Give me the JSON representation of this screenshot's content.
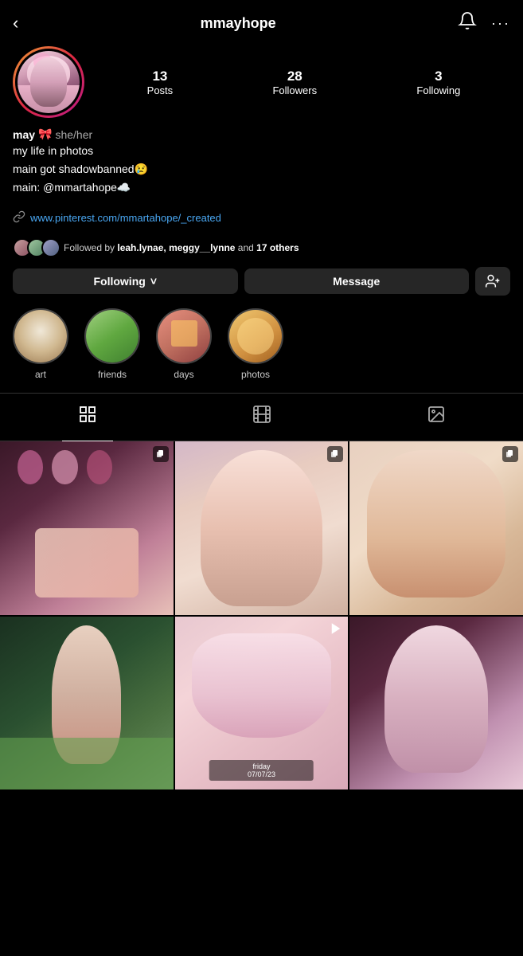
{
  "header": {
    "username": "mmayhope",
    "back_label": "‹",
    "bell_label": "🔔",
    "more_label": "···"
  },
  "stats": {
    "posts_count": "13",
    "posts_label": "Posts",
    "followers_count": "28",
    "followers_label": "Followers",
    "following_count": "3",
    "following_label": "Following"
  },
  "bio": {
    "name": "may",
    "bow": "🎀",
    "pronouns": "she/her",
    "line1": "my life in photos",
    "line2": "main got shadowbanned😢",
    "line3": "main: @mmartahope☁️"
  },
  "link": {
    "url": "www.pinterest.com/mmartahope/_created"
  },
  "followed_by": {
    "text_prefix": "Followed by ",
    "users": "leah.lynae, meggy__lynne",
    "text_suffix": " and ",
    "others_count": "17 others"
  },
  "buttons": {
    "following_label": "Following",
    "message_label": "Message",
    "chevron": "˅"
  },
  "highlights": [
    {
      "id": "art",
      "label": "art",
      "class": "hl-art-inner"
    },
    {
      "id": "friends",
      "label": "friends",
      "class": "hl-friends-inner"
    },
    {
      "id": "days",
      "label": "days",
      "class": "hl-days-inner"
    },
    {
      "id": "photos",
      "label": "photos",
      "class": "hl-photos-inner"
    }
  ],
  "tabs": {
    "grid_icon": "⊞",
    "reels_icon": "▶",
    "tagged_icon": "◫"
  },
  "grid": [
    {
      "id": "p1",
      "class": "p1",
      "has_badge": true,
      "badge_type": "multi"
    },
    {
      "id": "p2",
      "class": "p2",
      "has_badge": true,
      "badge_type": "multi"
    },
    {
      "id": "p3",
      "class": "p3",
      "has_badge": true,
      "badge_type": "multi"
    },
    {
      "id": "p4",
      "class": "p4",
      "has_badge": false,
      "badge_type": ""
    },
    {
      "id": "p5",
      "class": "p5",
      "has_badge": true,
      "badge_type": "reel"
    },
    {
      "id": "p6",
      "class": "p6",
      "has_badge": false,
      "badge_type": ""
    }
  ]
}
